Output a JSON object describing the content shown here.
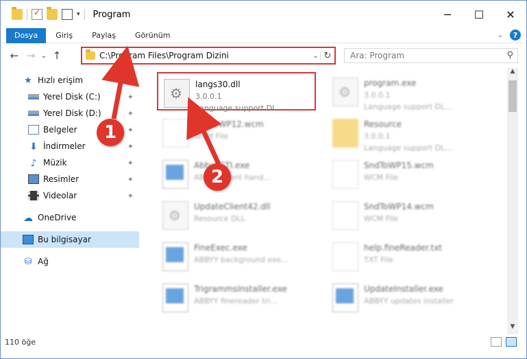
{
  "window": {
    "title": "Program",
    "minimize": "─",
    "maximize": "☐",
    "close": "✕"
  },
  "ribbon": {
    "tabs": [
      "Dosya",
      "Giriş",
      "Paylaş",
      "Görünüm"
    ],
    "help": "?",
    "expand": "⌄"
  },
  "nav": {
    "back": "←",
    "forward": "→",
    "recent": "⌄",
    "up": "↑",
    "address": "C:\\Program Files\\Program Dizini",
    "address_dropdown": "⌄",
    "refresh": "↻",
    "search_placeholder": "Ara: Program",
    "search_icon": "⚲"
  },
  "sidebar": {
    "items": [
      {
        "label": "Hızlı erişim",
        "icon": "star-icon"
      },
      {
        "label": "Yerel Disk (C:)",
        "icon": "disk-icon",
        "pinned": true
      },
      {
        "label": "Yerel Disk (D:)",
        "icon": "disk-icon",
        "pinned": true
      },
      {
        "label": "Belgeler",
        "icon": "document-icon",
        "pinned": true
      },
      {
        "label": "İndirmeler",
        "icon": "download-icon",
        "pinned": true
      },
      {
        "label": "Müzik",
        "icon": "music-icon",
        "pinned": true
      },
      {
        "label": "Resimler",
        "icon": "pictures-icon",
        "pinned": true
      },
      {
        "label": "Videolar",
        "icon": "videos-icon",
        "pinned": true
      },
      {
        "label": "OneDrive",
        "icon": "onedrive-icon"
      },
      {
        "label": "Bu bilgisayar",
        "icon": "computer-icon",
        "selected": true
      },
      {
        "label": "Ağ",
        "icon": "network-icon"
      }
    ],
    "pin_glyph": "📌"
  },
  "files": [
    {
      "name": "langs30.dll",
      "line1": "3.0.0.1",
      "line2": "Language support DL...",
      "icon": "gear-file-icon",
      "highlighted": true
    },
    {
      "name": "program.exe",
      "line1": "3.0.0.1",
      "line2": "Language support DL...",
      "icon": "app-icon"
    },
    {
      "name": "SndToWP12.wcm",
      "line1": "WCM File",
      "line2": "",
      "icon": "page-icon"
    },
    {
      "name": "Resource",
      "line1": "3.0.0.1",
      "line2": "Language support DL...",
      "icon": "folder-icon"
    },
    {
      "name": "AbbyySTI.exe",
      "line1": "ABBYY event hand...",
      "line2": "",
      "icon": "window-icon"
    },
    {
      "name": "SndToWP15.wcm",
      "line1": "WCM File",
      "line2": "",
      "icon": "page-icon"
    },
    {
      "name": "UpdateClient42.dll",
      "line1": "Resource DLL",
      "line2": "",
      "icon": "gear-file-icon"
    },
    {
      "name": "SndToWP14.wcm",
      "line1": "WCM File",
      "line2": "",
      "icon": "page-icon"
    },
    {
      "name": "FineExec.exe",
      "line1": "ABBYY background exe...",
      "line2": "",
      "icon": "window-icon"
    },
    {
      "name": "help.fineReader.txt",
      "line1": "TXT File",
      "line2": "",
      "icon": "page-icon"
    },
    {
      "name": "TrigrammsInstaller.exe",
      "line1": "ABBYY finereader tri...",
      "line2": "",
      "icon": "window-icon"
    },
    {
      "name": "UpdateInstaller.exe",
      "line1": "ABBYY updates installer",
      "line2": "",
      "icon": "window-icon"
    }
  ],
  "callouts": [
    "1",
    "2"
  ],
  "status": {
    "count": "110 öğe"
  },
  "colors": {
    "accent": "#1979ca",
    "highlight": "#d9353a",
    "callout": "#e0352b",
    "selected": "#cce4f7"
  }
}
